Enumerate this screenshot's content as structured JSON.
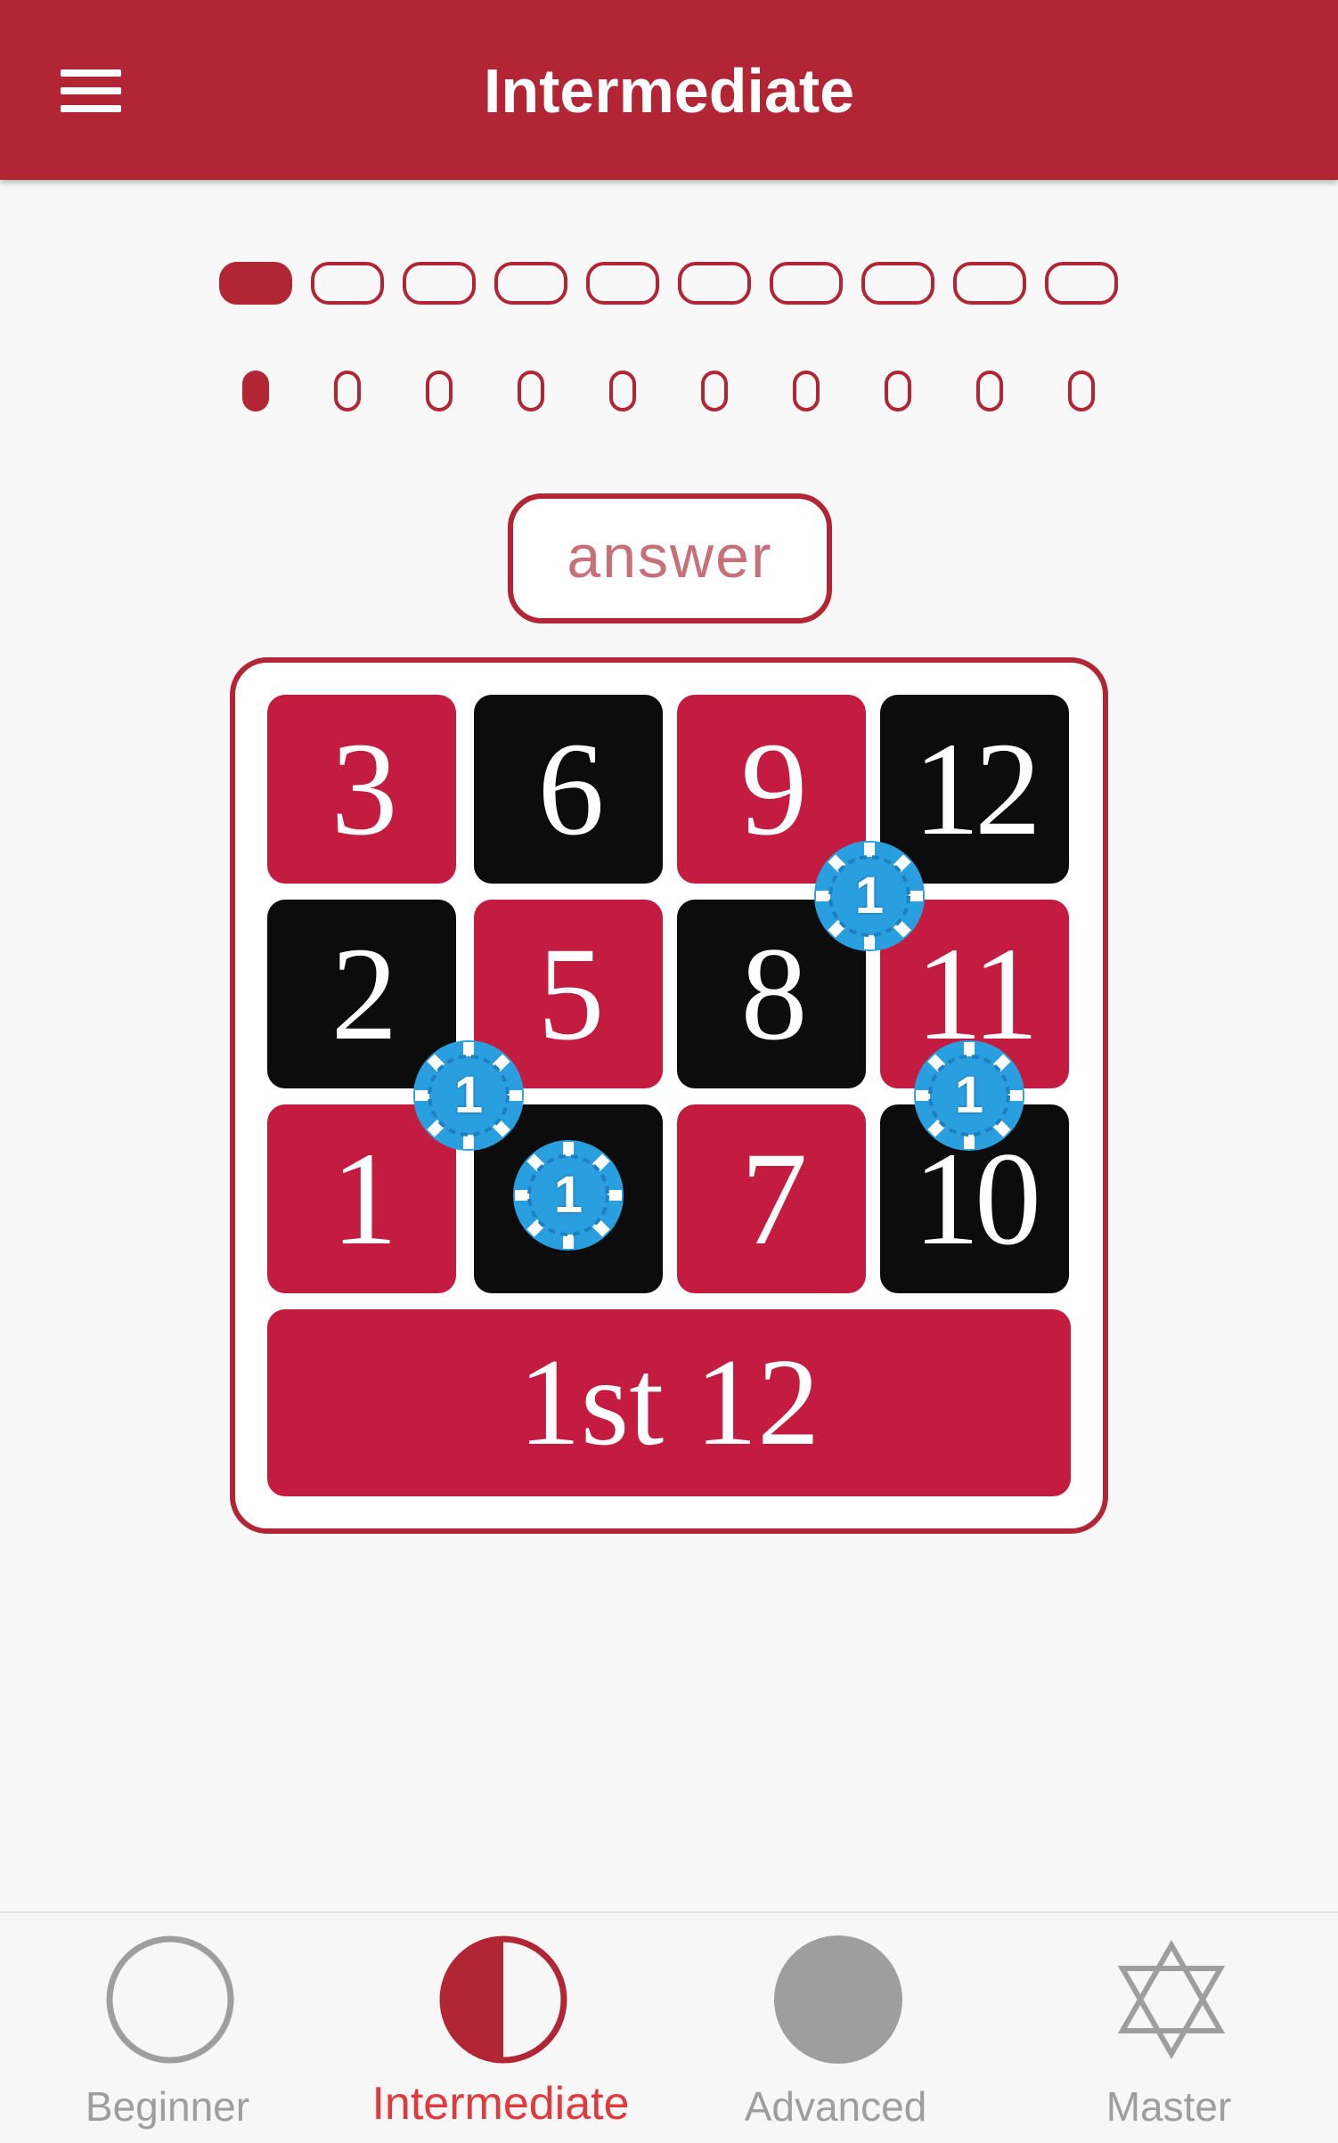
{
  "app_bar": {
    "title": "Intermediate",
    "menu_icon": "hamburger-menu-icon",
    "color": "#b22534"
  },
  "progress": {
    "bars": [
      true,
      false,
      false,
      false,
      false,
      false,
      false,
      false,
      false,
      false
    ],
    "pills": [
      true,
      false,
      false,
      false,
      false,
      false,
      false,
      false,
      false,
      false
    ]
  },
  "answer_button": {
    "label": "answer"
  },
  "board": {
    "rows": [
      [
        {
          "n": "3",
          "color": "red"
        },
        {
          "n": "6",
          "color": "black"
        },
        {
          "n": "9",
          "color": "red"
        },
        {
          "n": "12",
          "color": "black"
        }
      ],
      [
        {
          "n": "2",
          "color": "black"
        },
        {
          "n": "5",
          "color": "red"
        },
        {
          "n": "8",
          "color": "black"
        },
        {
          "n": "11",
          "color": "red"
        }
      ],
      [
        {
          "n": "1",
          "color": "red"
        },
        {
          "n": "4",
          "color": "black"
        },
        {
          "n": "7",
          "color": "red"
        },
        {
          "n": "10",
          "color": "black"
        }
      ]
    ],
    "dozen_label": "1st 12",
    "chips": [
      {
        "label": "1",
        "bet": "9-12-8-11 corner"
      },
      {
        "label": "1",
        "bet": "2-1 split"
      },
      {
        "label": "1",
        "bet": "4 straight"
      },
      {
        "label": "1",
        "bet": "11-10 split"
      }
    ],
    "chip_color": "#2a9fe0",
    "red_color": "#c41c41",
    "black_color": "#0c0c0c"
  },
  "bottom_nav": {
    "items": [
      {
        "label": "Beginner",
        "icon": "empty-circle-icon",
        "active": false
      },
      {
        "label": "Intermediate",
        "icon": "half-circle-icon",
        "active": true
      },
      {
        "label": "Advanced",
        "icon": "filled-circle-icon",
        "active": false
      },
      {
        "label": "Master",
        "icon": "star-of-david-icon",
        "active": false
      }
    ],
    "active_color": "#e03a3f",
    "inactive_color": "#9e9e9e"
  }
}
